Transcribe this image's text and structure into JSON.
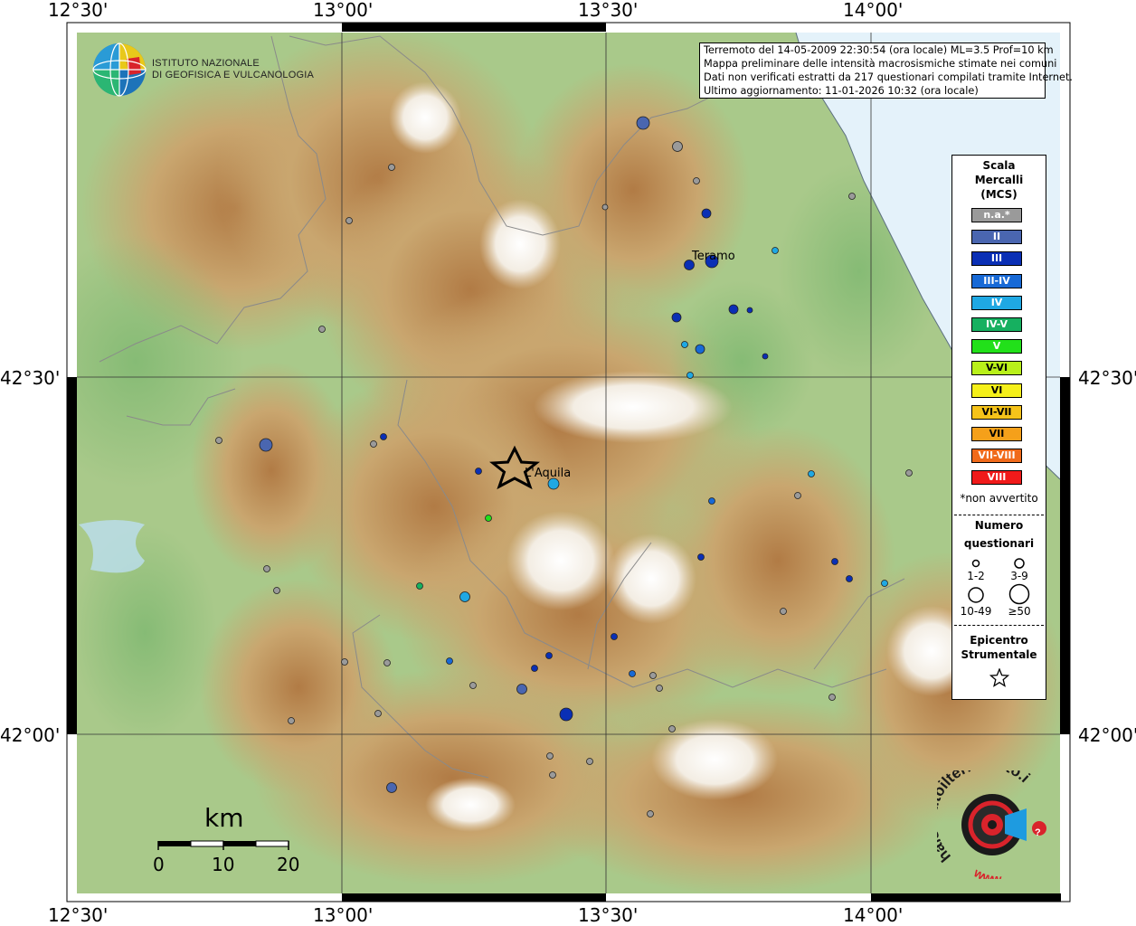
{
  "info": {
    "lines": [
      "Terremoto del 14-05-2009 22:30:54 (ora locale) ML=3.5 Prof=10 km",
      "Mappa preliminare delle intensità macrosismiche stimate nei comuni",
      "Dati non verificati estratti da 217 questionari compilati tramite Internet.",
      "Ultimo aggiornamento: 11-01-2026 10:32 (ora locale)"
    ]
  },
  "coordinates": {
    "top": [
      "12°30'",
      "13°00'",
      "13°30'",
      "14°00'"
    ],
    "bottom": [
      "12°30'",
      "13°00'",
      "13°30'",
      "14°00'"
    ],
    "left": [
      "42°30'",
      "42°00'"
    ],
    "right": [
      "42°30'",
      "42°00'"
    ]
  },
  "logo": {
    "line1": "ISTITUTO NAZIONALE",
    "line2": "DI GEOFISICA E VULCANOLOGIA"
  },
  "places": {
    "teramo": "Teramo",
    "aquila": "L'Aquila"
  },
  "scale_bar": {
    "unit": "km",
    "labels": [
      "0",
      "10",
      "20"
    ]
  },
  "legend": {
    "title": [
      "Scala",
      "Mercalli",
      "(MCS)"
    ],
    "items": [
      {
        "label": "n.a.*",
        "color": "#9a9a9a"
      },
      {
        "label": "II",
        "color": "#4a66b0"
      },
      {
        "label": "III",
        "color": "#0a2fb5"
      },
      {
        "label": "III-IV",
        "color": "#1769d6"
      },
      {
        "label": "IV",
        "color": "#1fa8e3"
      },
      {
        "label": "IV-V",
        "color": "#16b060"
      },
      {
        "label": "V",
        "color": "#22e01a"
      },
      {
        "label": "V-VI",
        "color": "#b9f01a"
      },
      {
        "label": "VI",
        "color": "#f5f01a"
      },
      {
        "label": "VI-VII",
        "color": "#f5c31a"
      },
      {
        "label": "VII",
        "color": "#f5a01a"
      },
      {
        "label": "VII-VIII",
        "color": "#f06a1a"
      },
      {
        "label": "VIII",
        "color": "#f01a1a"
      }
    ],
    "not_felt_note": "*non avvertito",
    "count_title": [
      "Numero",
      "questionari"
    ],
    "count_classes": [
      "1-2",
      "3-9",
      "10-49",
      "≥50"
    ],
    "epicenter_title": [
      "Epicentro",
      "Strumentale"
    ]
  },
  "badge": {
    "text": "haisentitoilterremoto.it",
    "url_text": "www.",
    "question": "?"
  },
  "colors": {
    "sea": "#e4f2fa",
    "lowland": "#9cc68a",
    "hills": "#d8c898",
    "mountains": "#b88a52",
    "peaks": "#ffffff"
  }
}
